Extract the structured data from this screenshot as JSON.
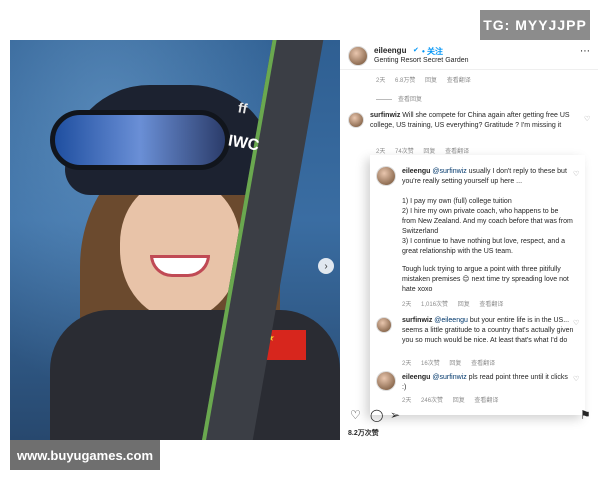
{
  "watermark_top": "TG: MYYJJPP",
  "watermark_bottom": "www.buyugames.com",
  "photo": {
    "ski_text_1": "ff",
    "ski_text_2": "IWC",
    "next_icon": "chevron-right-icon"
  },
  "post_header": {
    "username": "eileengu",
    "verified_icon": "verified-icon",
    "follow_label": "• 关注",
    "location": "Genting Resort Secret Garden",
    "more_icon": "more-icon"
  },
  "top_meta": {
    "time": "2天",
    "likes": "6.8万赞",
    "reply": "回复",
    "translate": "查看翻译"
  },
  "top_view_replies": "查看回复",
  "comments": [
    {
      "username": "surfinwiz",
      "text": "Will she compete for China again after getting free US college, US training, US everything? Gratitude ? I'm missing it",
      "time": "2天",
      "likes": "74次赞",
      "reply": "回复",
      "translate": "查看翻译"
    }
  ],
  "replies": [
    {
      "username": "eileengu",
      "mention": "@surfinwiz",
      "text_1": "usually I don't reply to these but you're really setting yourself up here ...",
      "text_2": "1) I pay my own (full) college tuition",
      "text_3": "2) I hire my own private coach, who happens to be from New Zealand. And my coach before that was from Switzerland",
      "text_4": "3) I continue to have nothing but love, respect, and a great relationship with the US team.",
      "text_5": "Tough luck trying to argue a point with three pitifully mistaken premises 😌 next time try spreading love not hate xoxo",
      "time": "2天",
      "likes": "1,016次赞",
      "reply": "回复",
      "translate": "查看翻译"
    },
    {
      "username": "surfinwiz",
      "mention": "@eileengu",
      "text": "but your entire life is in the US... seems a little gratitude to a country that's actually given you so much would be nice. At least that's what I'd do",
      "time": "2天",
      "likes": "16次赞",
      "reply": "回复",
      "translate": "查看翻译"
    },
    {
      "username": "eileengu",
      "mention": "@surfinwiz",
      "text": "pls read point three until it clicks :)",
      "time": "2天",
      "likes": "246次赞",
      "reply": "回复",
      "translate": "查看翻译"
    }
  ],
  "actions": {
    "like_icon": "heart-icon",
    "comment_icon": "comment-icon",
    "share_icon": "share-icon",
    "save_icon": "bookmark-icon"
  },
  "total_likes": "8.2万次赞"
}
